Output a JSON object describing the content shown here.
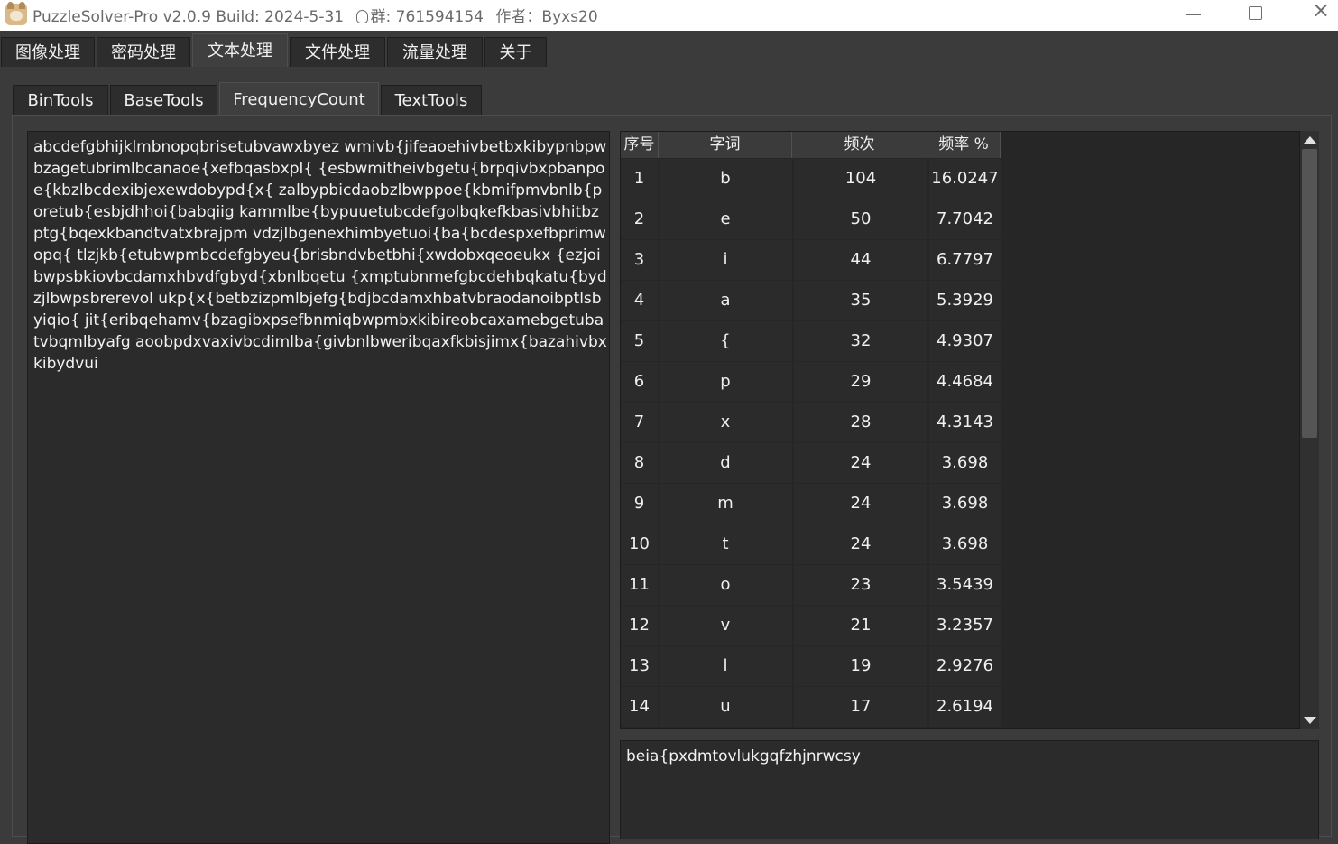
{
  "window": {
    "title_main": "PuzzleSolver-Pro v2.0.9 Build: 2024-5-31",
    "title_group": "群: 761594154",
    "title_author": "作者：Byxs20"
  },
  "main_tabs": [
    {
      "label": "图像处理",
      "active": false
    },
    {
      "label": "密码处理",
      "active": false
    },
    {
      "label": "文本处理",
      "active": true
    },
    {
      "label": "文件处理",
      "active": false
    },
    {
      "label": "流量处理",
      "active": false
    },
    {
      "label": "关于",
      "active": false
    }
  ],
  "sub_tabs": [
    {
      "label": "BinTools",
      "active": false
    },
    {
      "label": "BaseTools",
      "active": false
    },
    {
      "label": "FrequencyCount",
      "active": true
    },
    {
      "label": "TextTools",
      "active": false
    }
  ],
  "input_text": "abcdefgbhijklmbnopqbrisetubvawxbyez wmivb{jifeaoehivbetbxkibypnbpwbzagetubrimlbcanaoe{xefbqasbxpl{ {esbwmitheivbgetu{brpqivbxpbanpoe{kbzlbcdexibjexewdobypd{x{ zalbypbicdaobzlbwppoe{kbmifpmvbnlb{poretub{esbjdhhoi{babqiig kammlbe{bypuuetubcdefgolbqkefkbasivbhitbzptg{bqexkbandtvatxbrajpm vdzjlbgenexhimbyetuoi{ba{bcdespxefbprimwopq{ tlzjkb{etubwpmbcdefgbyeu{brisbndvbetbhi{xwdobxqeoeukx {ezjoibwpsbkiovbcdamxhbvdfgbyd{xbnlbqetu {xmptubnmefgbcdehbqkatu{bydzjlbwpsbrerevol ukp{x{betbzizpmlbjefg{bdjbcdamxhbatvbraodanoibptlsbyiqio{ jit{eribqehamv{bzagibxpsefbnmiqbwpmbxkibireobcaxamebgetubatvbqmlbyafg aoobpdxvaxivbcdimlba{givbnlbweribqaxfkbisjimx{bazahivbxkibydvui",
  "table": {
    "headers": [
      "序号",
      "字词",
      "频次",
      "频率 %"
    ],
    "rows": [
      [
        "1",
        "b",
        "104",
        "16.0247"
      ],
      [
        "2",
        "e",
        "50",
        "7.7042"
      ],
      [
        "3",
        "i",
        "44",
        "6.7797"
      ],
      [
        "4",
        "a",
        "35",
        "5.3929"
      ],
      [
        "5",
        "{",
        "32",
        "4.9307"
      ],
      [
        "6",
        "p",
        "29",
        "4.4684"
      ],
      [
        "7",
        "x",
        "28",
        "4.3143"
      ],
      [
        "8",
        "d",
        "24",
        "3.698"
      ],
      [
        "9",
        "m",
        "24",
        "3.698"
      ],
      [
        "10",
        "t",
        "24",
        "3.698"
      ],
      [
        "11",
        "o",
        "23",
        "3.5439"
      ],
      [
        "12",
        "v",
        "21",
        "3.2357"
      ],
      [
        "13",
        "l",
        "19",
        "2.9276"
      ],
      [
        "14",
        "u",
        "17",
        "2.6194"
      ]
    ]
  },
  "output_text": "beia{pxdmtovlukgqfzhjnrwcsy",
  "colors": {
    "background": "#3b3b3b",
    "textbox": "#2b2b2b",
    "table_bg": "#262626",
    "text": "#f0f0f0"
  }
}
